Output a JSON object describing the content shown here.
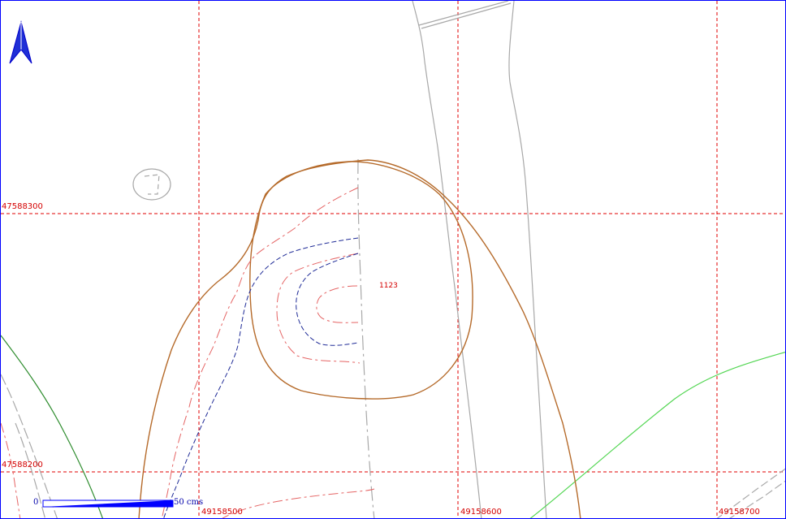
{
  "map": {
    "grid_labels": {
      "y": [
        "47588300",
        "47588200"
      ],
      "x": [
        "49158500",
        "49158600",
        "49158700"
      ]
    },
    "contour_label": "1123",
    "scale_bar": {
      "start_label": "0",
      "end_label": "50  cms"
    },
    "north_arrow": {
      "icon": "north-arrow-icon"
    },
    "colors": {
      "grid": "#e00000",
      "frame": "#0000ff",
      "brown_contour": "#b56a2a",
      "red_dashed_contour": "#e56464",
      "blue_dashed_contour": "#1f2b97",
      "road": "#a8a8a8",
      "green_line": "#2f8d2f",
      "light_green_line": "#53d653",
      "scale_bar": "#0000ff",
      "north_arrow": "#0000cc"
    }
  }
}
